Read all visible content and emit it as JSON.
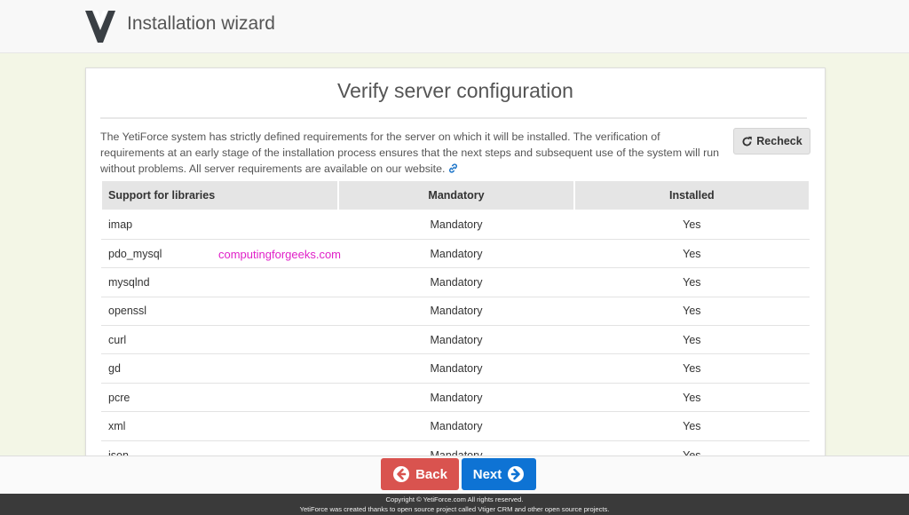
{
  "header": {
    "title": "Installation wizard",
    "logo_icon": "yetiforce-logo-icon"
  },
  "panel": {
    "title": "Verify server configuration",
    "description": "The YetiForce system has strictly defined requirements for the server on which it will be installed. The verification of requirements at an early stage of the installation process ensures that the next steps and subsequent use of the system will run without problems. All server requirements are available on our website.",
    "recheck_label": "Recheck",
    "link_icon": "link-icon"
  },
  "table": {
    "headers": [
      "Support for libraries",
      "Mandatory",
      "Installed"
    ],
    "rows": [
      [
        "imap",
        "Mandatory",
        "Yes"
      ],
      [
        "pdo_mysql",
        "Mandatory",
        "Yes"
      ],
      [
        "mysqlnd",
        "Mandatory",
        "Yes"
      ],
      [
        "openssl",
        "Mandatory",
        "Yes"
      ],
      [
        "curl",
        "Mandatory",
        "Yes"
      ],
      [
        "gd",
        "Mandatory",
        "Yes"
      ],
      [
        "pcre",
        "Mandatory",
        "Yes"
      ],
      [
        "xml",
        "Mandatory",
        "Yes"
      ],
      [
        "json",
        "Mandatory",
        "Yes"
      ]
    ]
  },
  "watermark": "computingforgeeks.com",
  "nav": {
    "back_label": "Back",
    "next_label": "Next"
  },
  "footer": {
    "line1": "Copyright © YetiForce.com All rights reserved.",
    "line2": "YetiForce was created thanks to open source project called Vtiger CRM and other open source projects."
  },
  "colors": {
    "back": "#d9534f",
    "next": "#0e73d4",
    "watermark": "#e020c8",
    "page_bg": "#f3f6e6"
  }
}
